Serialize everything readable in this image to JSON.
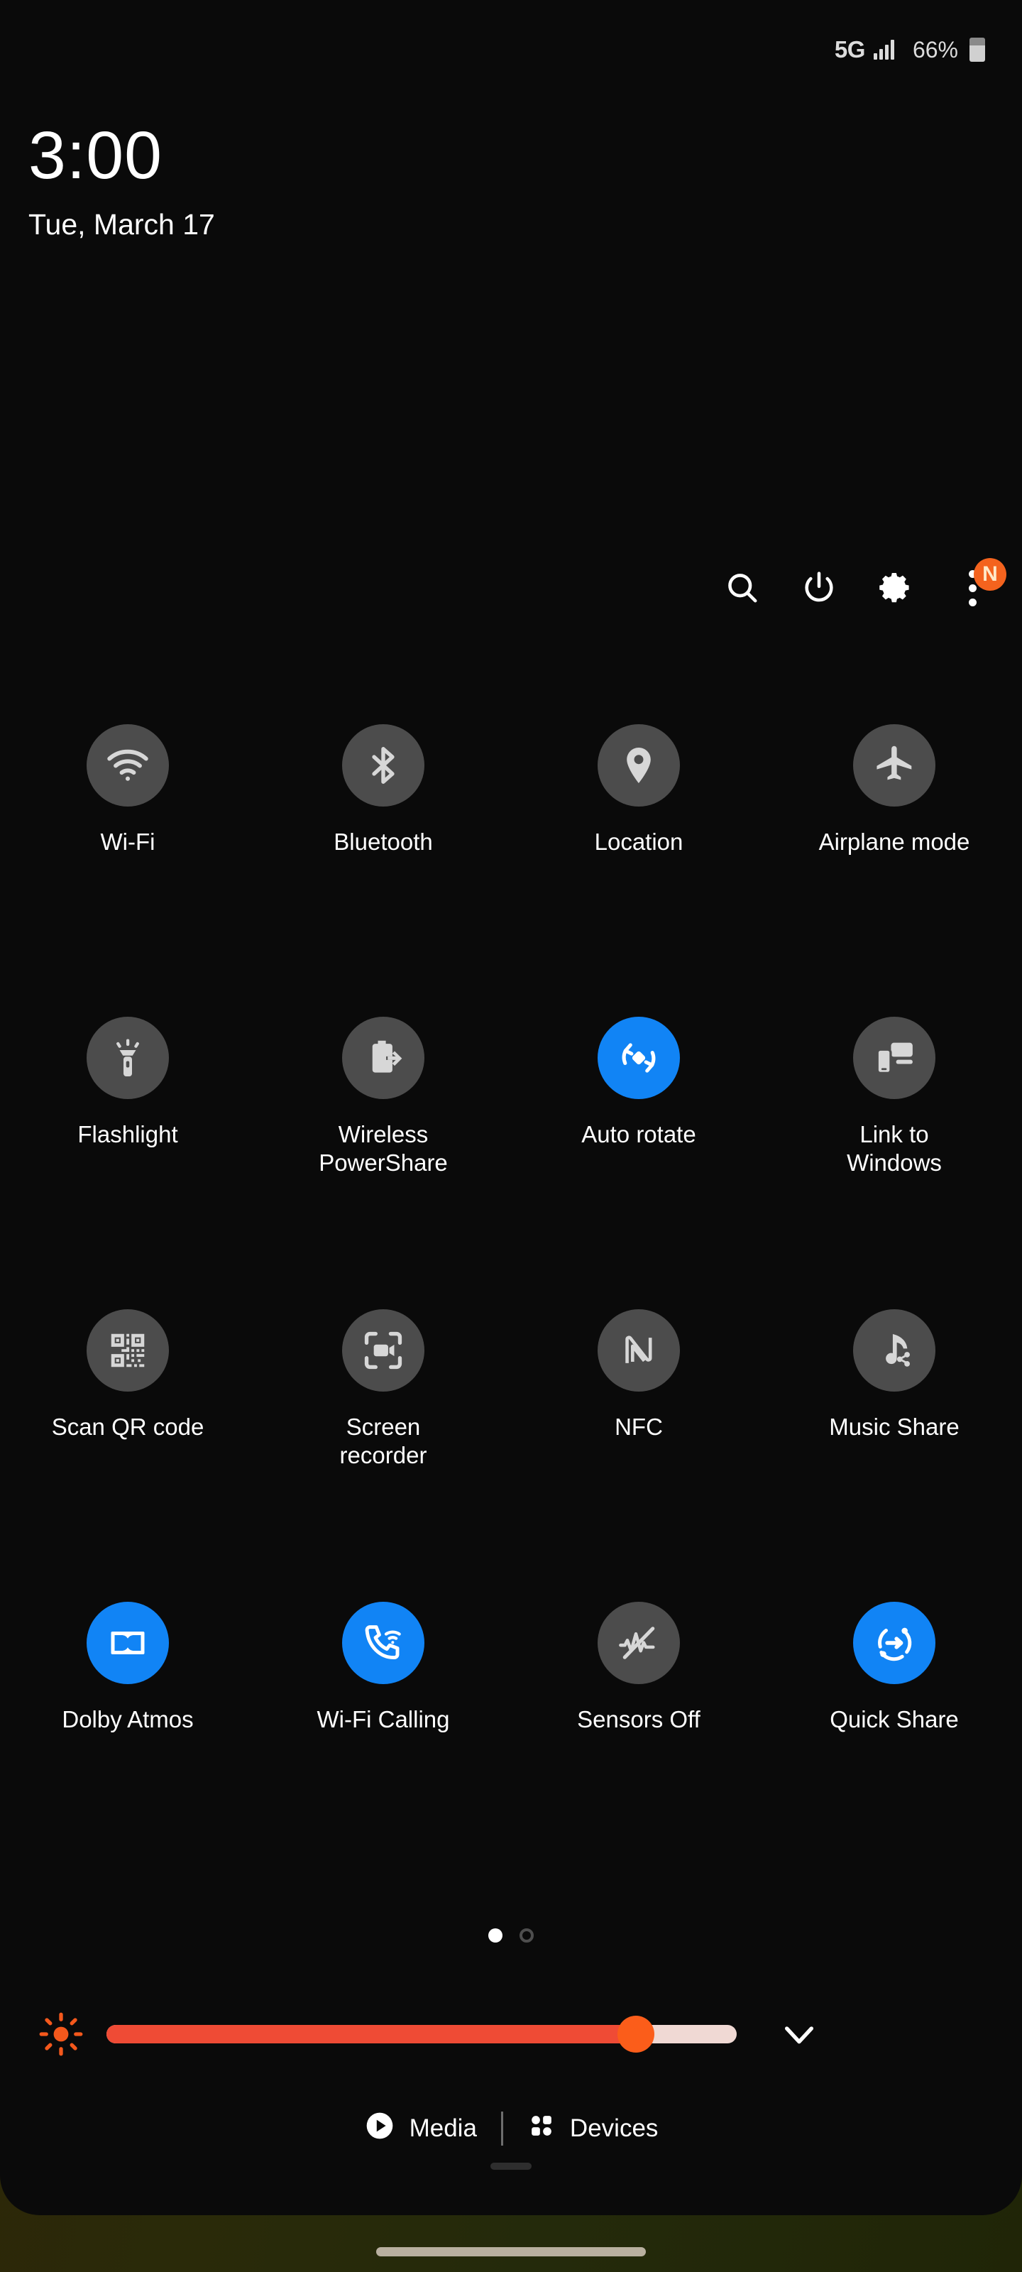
{
  "status_bar": {
    "network_type": "5G",
    "signal_icon": "signal-bars-icon",
    "battery_percent": "66%",
    "battery_icon": "battery-icon"
  },
  "clock": {
    "time": "3:00",
    "date": "Tue, March 17"
  },
  "header": {
    "buttons": [
      {
        "name": "search-icon",
        "label": "Search"
      },
      {
        "name": "power-icon",
        "label": "Power off"
      },
      {
        "name": "gear-icon",
        "label": "Settings"
      },
      {
        "name": "overflow-menu-icon",
        "label": "More options"
      }
    ],
    "notification_badge": "N"
  },
  "colors": {
    "tile_on": "#1184f5",
    "tile_off": "#4c4c4c",
    "badge": "#f4631e",
    "brightness_fill": "#ef4b35",
    "brightness_thumb": "#fb5d1a",
    "panel_background": "#0a0a0a"
  },
  "tiles": [
    {
      "label": "Wi-Fi",
      "icon": "wifi-icon",
      "state": "off"
    },
    {
      "label": "Bluetooth",
      "icon": "bluetooth-icon",
      "state": "off"
    },
    {
      "label": "Location",
      "icon": "location-pin-icon",
      "state": "off"
    },
    {
      "label": "Airplane mode",
      "icon": "airplane-icon",
      "state": "off"
    },
    {
      "label": "Flashlight",
      "icon": "flashlight-icon",
      "state": "off"
    },
    {
      "label": "Wireless PowerShare",
      "icon": "wireless-powershare-icon",
      "state": "off"
    },
    {
      "label": "Auto rotate",
      "icon": "auto-rotate-icon",
      "state": "on"
    },
    {
      "label": "Link to Windows",
      "icon": "link-to-windows-icon",
      "state": "off"
    },
    {
      "label": "Scan QR code",
      "icon": "qr-code-icon",
      "state": "off"
    },
    {
      "label": "Screen recorder",
      "icon": "screen-recorder-icon",
      "state": "off"
    },
    {
      "label": "NFC",
      "icon": "nfc-icon",
      "state": "off"
    },
    {
      "label": "Music Share",
      "icon": "music-share-icon",
      "state": "off"
    },
    {
      "label": "Dolby Atmos",
      "icon": "dolby-atmos-icon",
      "state": "on"
    },
    {
      "label": "Wi-Fi Calling",
      "icon": "wifi-calling-icon",
      "state": "on"
    },
    {
      "label": "Sensors Off",
      "icon": "sensors-off-icon",
      "state": "off"
    },
    {
      "label": "Quick Share",
      "icon": "quick-share-icon",
      "state": "on"
    }
  ],
  "pagination": {
    "total_pages": 2,
    "current_page": 1
  },
  "brightness": {
    "icon": "brightness-sun-icon",
    "value_percent": 84,
    "expand_icon": "chevron-down-icon"
  },
  "footer": {
    "media": {
      "label": "Media",
      "icon": "play-circle-icon"
    },
    "devices": {
      "label": "Devices",
      "icon": "devices-grid-icon"
    }
  }
}
